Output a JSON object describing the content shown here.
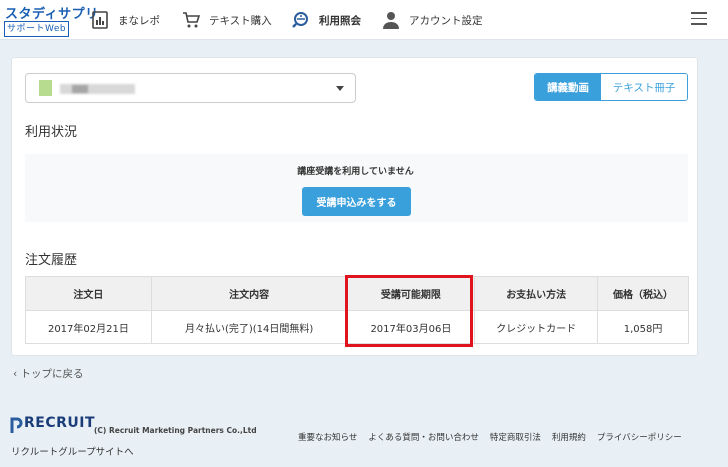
{
  "header": {
    "logo_main": "スタディサプリ",
    "logo_sub": "サポートWeb",
    "nav": [
      {
        "label": "まなレポ",
        "icon": "report-icon"
      },
      {
        "label": "テキスト購入",
        "icon": "cart-icon"
      },
      {
        "label": "利用照会",
        "icon": "search-icon"
      },
      {
        "label": "アカウント設定",
        "icon": "user-icon"
      }
    ],
    "active_nav": "利用照会"
  },
  "toggle": {
    "lecture_label": "講義動画",
    "text_label": "テキスト冊子"
  },
  "usage": {
    "title": "利用状況",
    "message": "講座受講を利用していません",
    "apply_label": "受講申込みをする"
  },
  "orders": {
    "title": "注文履歴",
    "columns": [
      "注文日",
      "注文内容",
      "受講可能期限",
      "お支払い方法",
      "価格（税込）"
    ],
    "rows": [
      [
        "2017年02月21日",
        "月々払い(完了)(14日間無料)",
        "2017年03月06日",
        "クレジットカード",
        "1,058円"
      ]
    ]
  },
  "back_label": "トップに戻る",
  "footer": {
    "brand": "RECRUIT",
    "copyright": "(C) Recruit Marketing Partners Co.,Ltd",
    "group_link": "リクルートグループサイトへ",
    "links": [
      "重要なお知らせ",
      "よくある質問・お問い合わせ",
      "特定商取引法",
      "利用規約",
      "プライバシーポリシー"
    ]
  },
  "colors": {
    "accent": "#3aa0dc",
    "highlight": "#e0141e",
    "brand": "#1a5fb4"
  }
}
